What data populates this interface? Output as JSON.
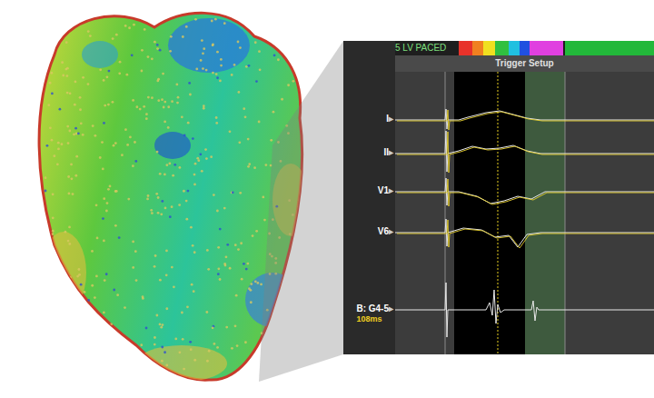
{
  "header": {
    "title": "5 LV PACED",
    "segments": [
      {
        "color": "#e8322a"
      },
      {
        "color": "#f08020"
      },
      {
        "color": "#f0e020"
      },
      {
        "color": "#30c040"
      },
      {
        "color": "#20c0e0"
      },
      {
        "color": "#2050e0"
      },
      {
        "color": "#e040e0"
      },
      {
        "color": "#22b83a"
      }
    ]
  },
  "subheader": "Trigger Setup",
  "traces": [
    {
      "label": "I",
      "marker": "▸",
      "template": true,
      "points": [
        [
          0,
          0
        ],
        [
          55,
          0
        ],
        [
          56,
          1.2
        ],
        [
          57,
          -1
        ],
        [
          58,
          0
        ],
        [
          70,
          0
        ],
        [
          80,
          0.3
        ],
        [
          100,
          0.8
        ],
        [
          115,
          1
        ],
        [
          130,
          0.6
        ],
        [
          145,
          0.2
        ],
        [
          160,
          0
        ],
        [
          285,
          0
        ]
      ]
    },
    {
      "label": "II",
      "marker": "▸",
      "template": true,
      "points": [
        [
          0,
          0
        ],
        [
          55,
          0
        ],
        [
          56,
          2.5
        ],
        [
          57,
          -2
        ],
        [
          58,
          0
        ],
        [
          70,
          0.3
        ],
        [
          85,
          0.8
        ],
        [
          100,
          0.5
        ],
        [
          115,
          0.6
        ],
        [
          130,
          0.9
        ],
        [
          145,
          0.3
        ],
        [
          160,
          0
        ],
        [
          285,
          0
        ]
      ]
    },
    {
      "label": "V1",
      "marker": "▸",
      "template": true,
      "points": [
        [
          0,
          0
        ],
        [
          55,
          0
        ],
        [
          56,
          1.5
        ],
        [
          57,
          -1.5
        ],
        [
          58,
          0
        ],
        [
          70,
          0
        ],
        [
          90,
          -0.5
        ],
        [
          105,
          -1.3
        ],
        [
          120,
          -1
        ],
        [
          135,
          -0.5
        ],
        [
          150,
          -0.8
        ],
        [
          165,
          0
        ],
        [
          285,
          0
        ]
      ]
    },
    {
      "label": "V6",
      "marker": "▸",
      "template": true,
      "points": [
        [
          0,
          0
        ],
        [
          55,
          0
        ],
        [
          56,
          1.5
        ],
        [
          57,
          -1.5
        ],
        [
          58,
          0
        ],
        [
          75,
          0.5
        ],
        [
          95,
          0.3
        ],
        [
          110,
          -0.5
        ],
        [
          125,
          -0.3
        ],
        [
          135,
          -1.6
        ],
        [
          145,
          -0.2
        ],
        [
          160,
          0
        ],
        [
          285,
          0
        ]
      ]
    },
    {
      "label": "B: G4-5",
      "marker": "▸",
      "reading": "108ms",
      "template": false,
      "points": [
        [
          0,
          0
        ],
        [
          55,
          0
        ],
        [
          56,
          3
        ],
        [
          57,
          -3
        ],
        [
          58,
          0
        ],
        [
          100,
          0
        ],
        [
          104,
          0.8
        ],
        [
          107,
          -0.6
        ],
        [
          109,
          2.2
        ],
        [
          111,
          -1.5
        ],
        [
          113,
          0.6
        ],
        [
          116,
          -0.3
        ],
        [
          120,
          0
        ],
        [
          150,
          0
        ],
        [
          152,
          1
        ],
        [
          154,
          -1.2
        ],
        [
          156,
          0.3
        ],
        [
          158,
          0
        ],
        [
          285,
          0
        ]
      ]
    }
  ]
}
